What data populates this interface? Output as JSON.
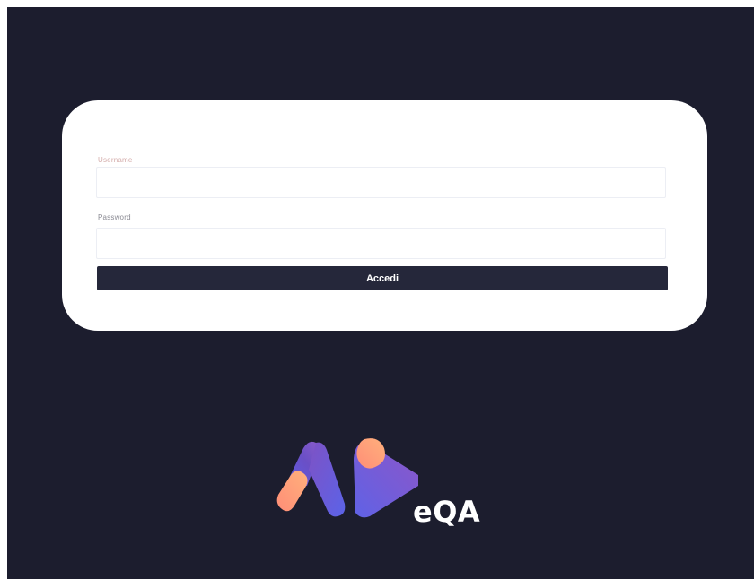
{
  "login_form": {
    "username_label": "Username",
    "username_value": "",
    "password_label": "Password",
    "password_value": "",
    "submit_label": "Accedi"
  },
  "brand": {
    "name": "eQA",
    "logo_icon": "eqa-logo-icon"
  },
  "colors": {
    "background": "#1c1d2e",
    "card": "#ffffff",
    "button": "#25273a",
    "logo_gradient_start": "#ffa17a",
    "logo_gradient_end": "#5b5fe8"
  }
}
